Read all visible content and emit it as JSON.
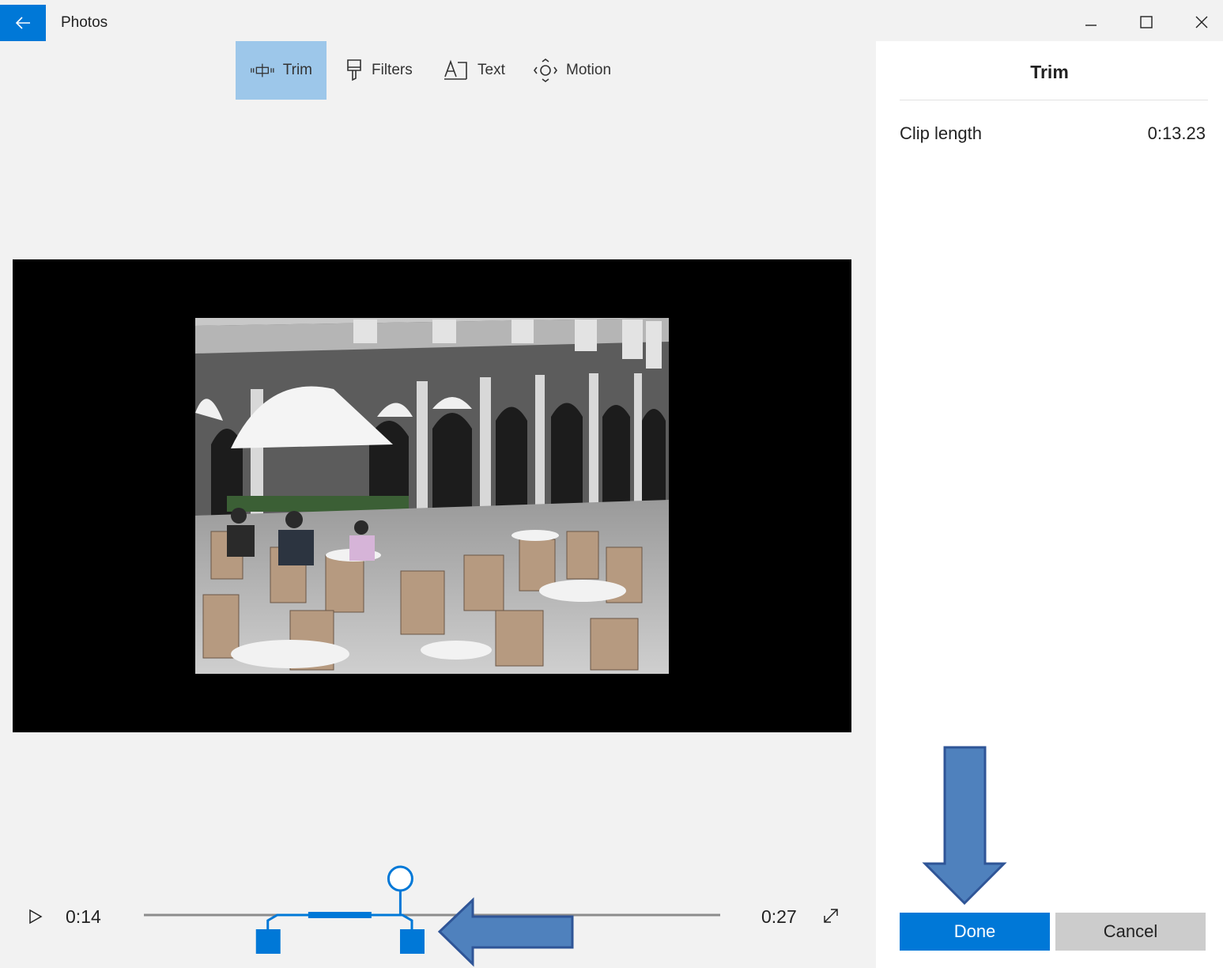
{
  "app": {
    "title": "Photos"
  },
  "toolbar": {
    "trim_label": "Trim",
    "filters_label": "Filters",
    "text_label": "Text",
    "motion_label": "Motion"
  },
  "timeline": {
    "current_time": "0:14",
    "end_time": "0:27",
    "trim_start_fraction": 0.215,
    "trim_end_fraction": 0.465,
    "playhead_fraction": 0.445
  },
  "panel": {
    "title": "Trim",
    "clip_length_label": "Clip length",
    "clip_length_value": "0:13.23",
    "done_label": "Done",
    "cancel_label": "Cancel"
  },
  "colors": {
    "accent": "#0078d7",
    "active_tool": "#9dc7ea",
    "annotation_arrow": "#4f81bd"
  }
}
